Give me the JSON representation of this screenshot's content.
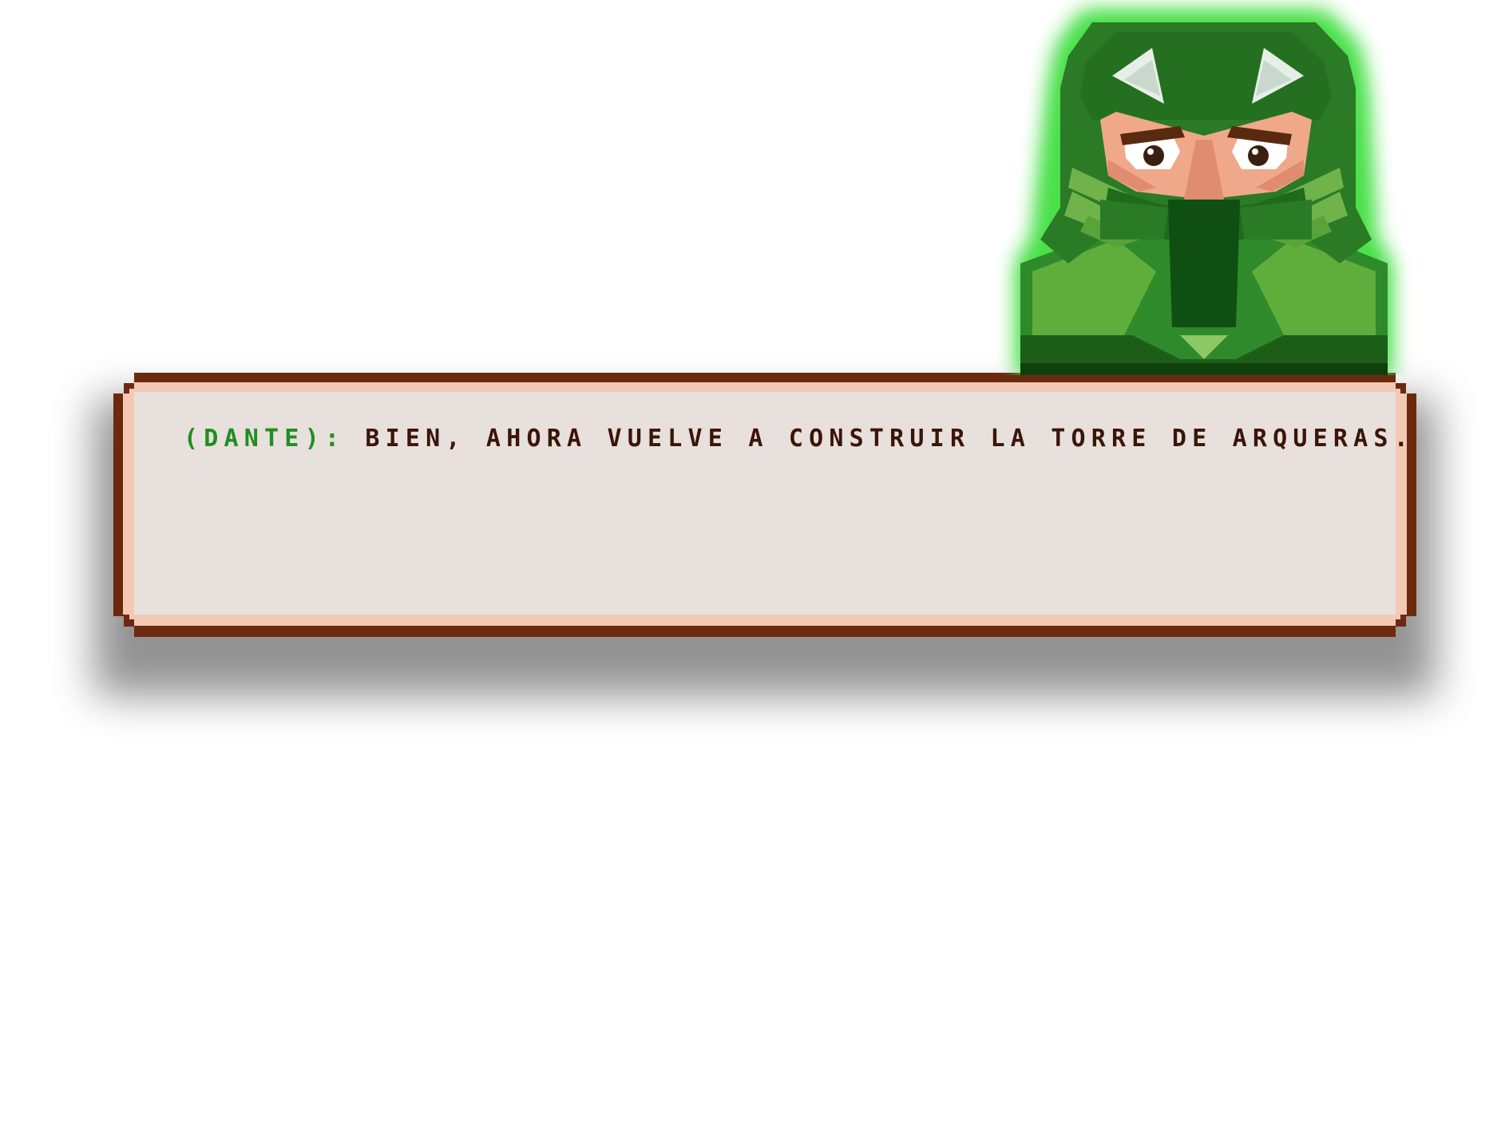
{
  "dialog": {
    "speaker": "(DANTE):",
    "message": "BIEN, AHORA VUELVE A CONSTRUIR LA TORRE DE ARQUERAS."
  },
  "portrait": {
    "icon": "masked-green-ninja-portrait"
  },
  "colors": {
    "speaker": "#1f8f1f",
    "message": "#3a1508",
    "border": "#6b2a10",
    "panel": "#e8e0dd",
    "glow": "#4de04d"
  }
}
